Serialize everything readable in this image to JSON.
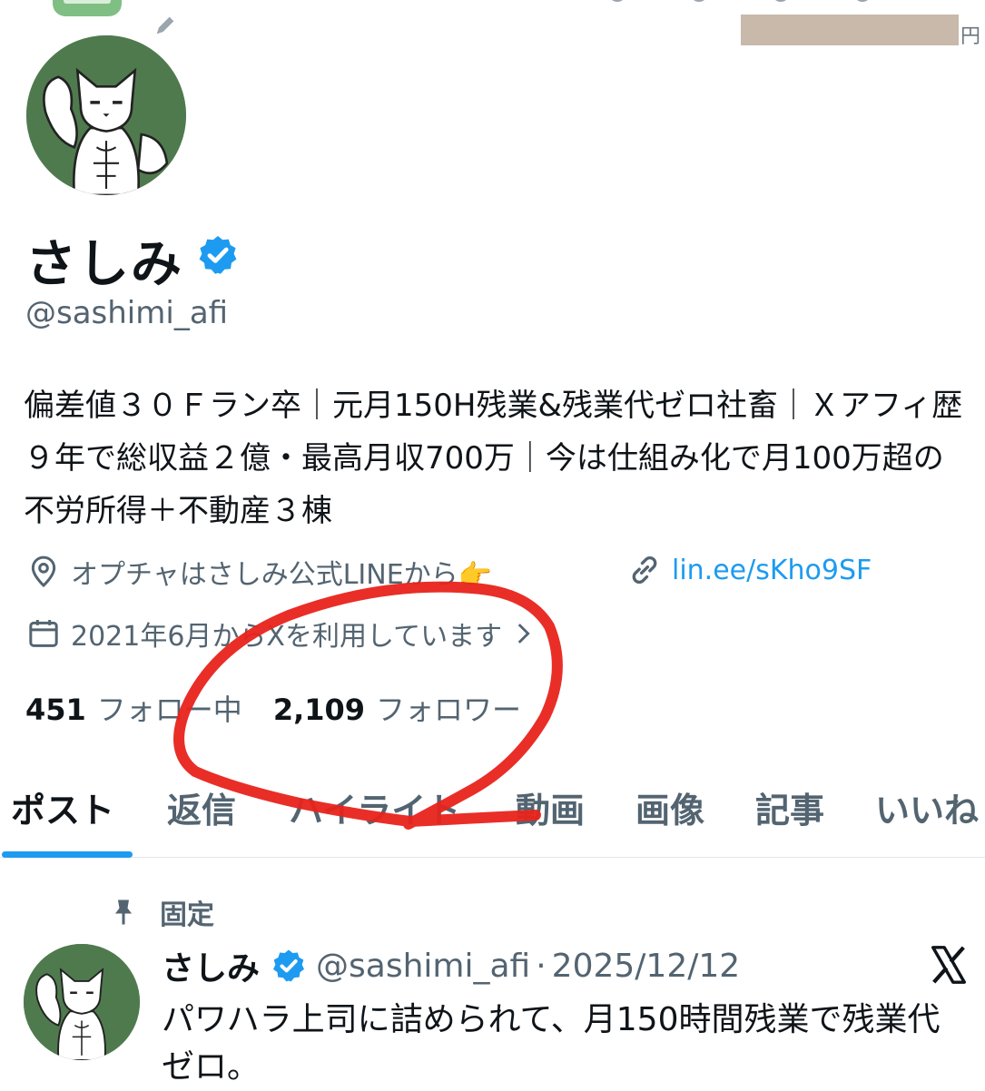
{
  "header": {
    "currency_unit": "円"
  },
  "profile": {
    "display_name": "さしみ",
    "handle": "@sashimi_afi",
    "bio": "偏差値３０Ｆラン卒｜元月150H残業&残業代ゼロ社畜｜Ｘアフィ歴９年で総収益２億・最高月収700万｜今は仕組み化で月100万超の不労所得＋不動産３棟",
    "location": "オプチャはさしみ公式LINEから👉",
    "link": "lin.ee/sKho9SF",
    "joined": "2021年6月からXを利用しています",
    "following_count": "451",
    "following_label": "フォロー中",
    "followers_count": "2,109",
    "followers_label": "フォロワー"
  },
  "tabs": [
    {
      "label": "ポスト",
      "active": true
    },
    {
      "label": "返信"
    },
    {
      "label": "ハイライト"
    },
    {
      "label": "動画"
    },
    {
      "label": "画像"
    },
    {
      "label": "記事"
    },
    {
      "label": "いいね"
    }
  ],
  "pinned_post": {
    "pinned_label": "固定",
    "name": "さしみ",
    "handle": "@sashimi_afi",
    "separator": "·",
    "date": "2025/12/12",
    "text": "パワハラ上司に詰められて、月150時間残業で残業代ゼロ。"
  },
  "colors": {
    "accent": "#1d9bf0",
    "annotation": "#e8231b",
    "avatar_bg": "#4f7a4e"
  },
  "icons": [
    "pencil-icon",
    "verified-icon",
    "location-icon",
    "link-icon",
    "calendar-icon",
    "chevron-right-icon",
    "pin-icon",
    "x-logo-icon"
  ]
}
